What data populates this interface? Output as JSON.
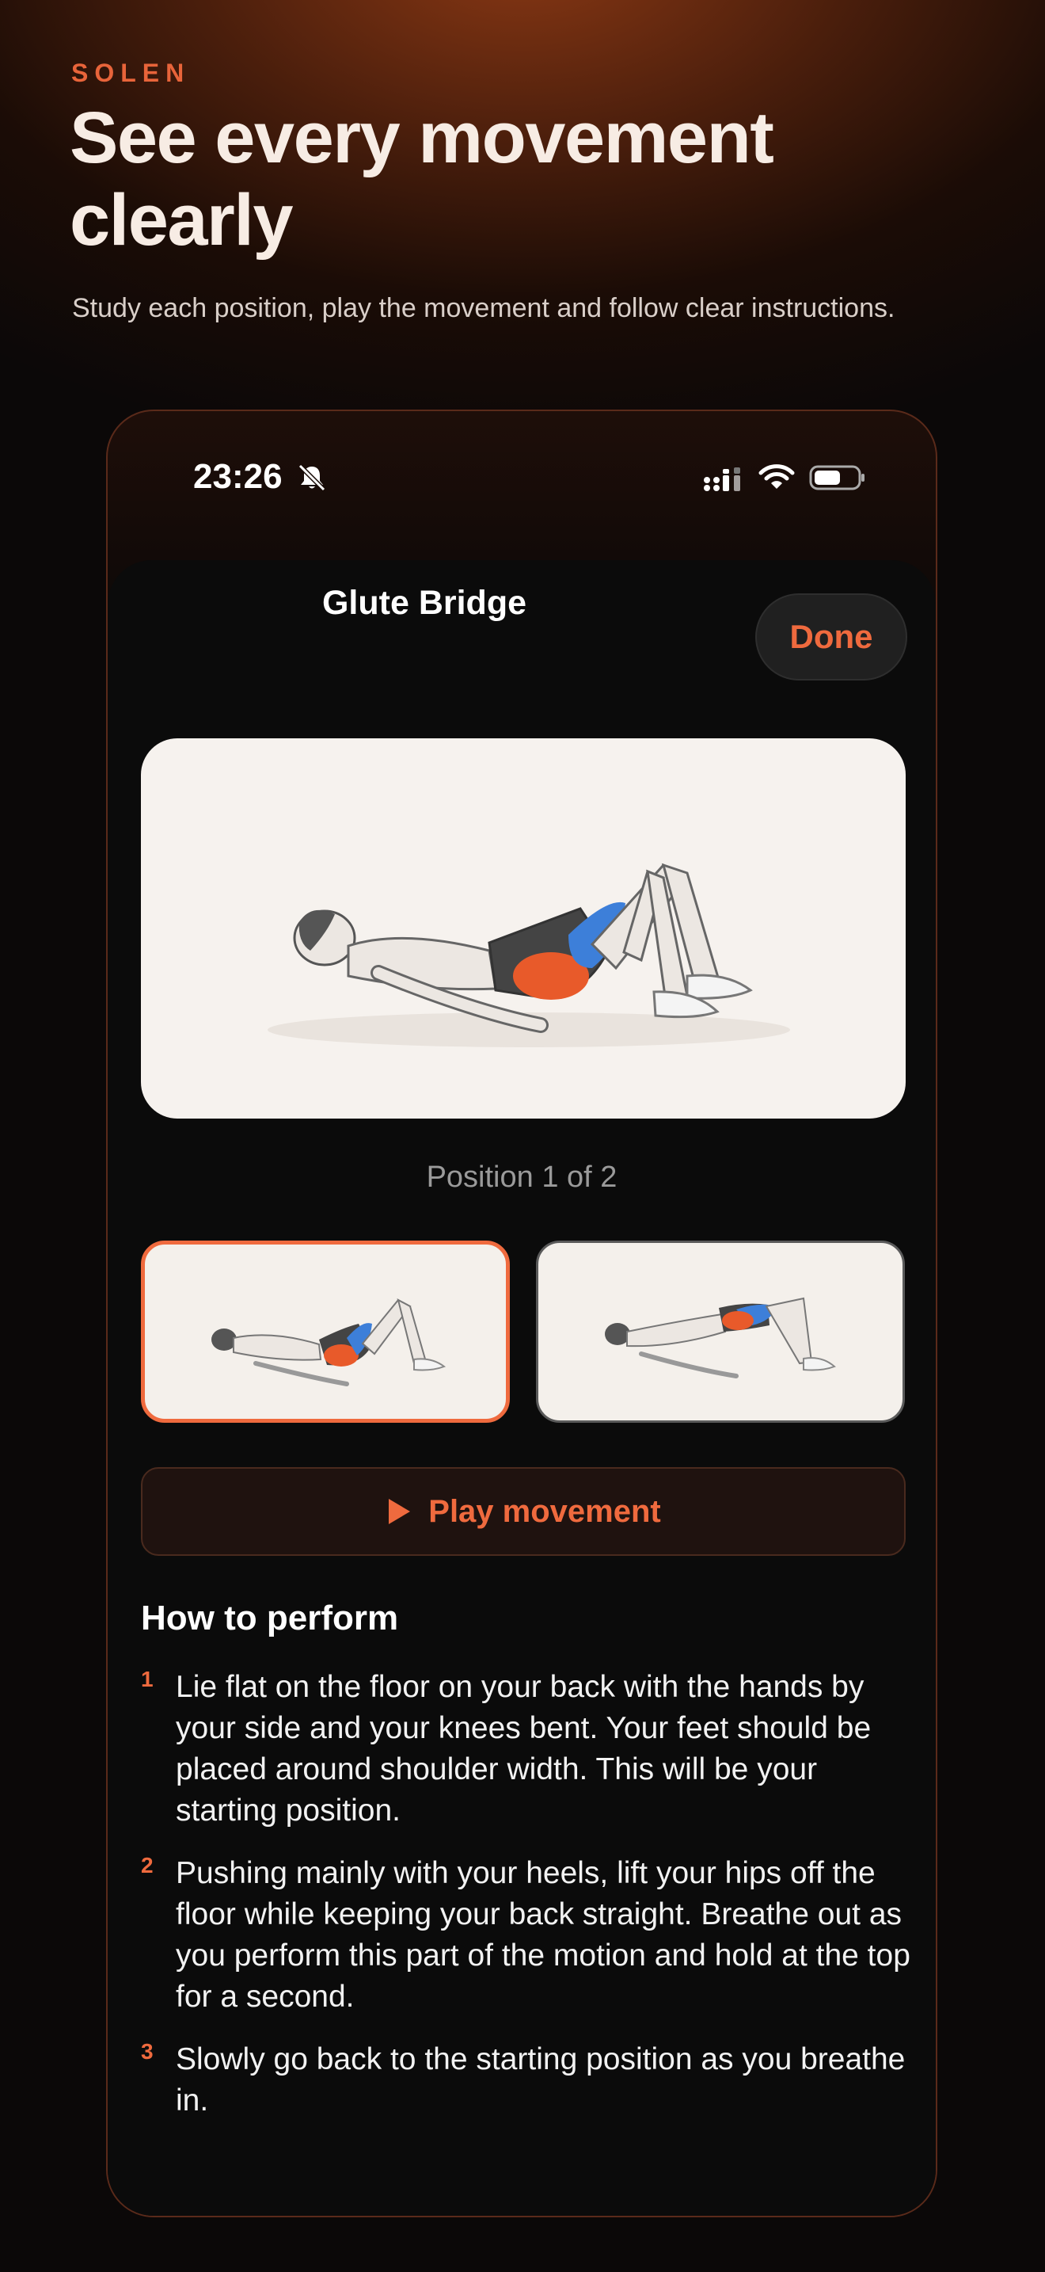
{
  "marketing": {
    "brand": "SOLEN",
    "headline": "See every movement clearly",
    "subtitle": "Study each position, play the movement and follow clear instructions."
  },
  "status_bar": {
    "time": "23:26",
    "icons": [
      "bell-slash-icon",
      "cellular-signal-icon",
      "wifi-icon",
      "battery-icon"
    ]
  },
  "exercise": {
    "title": "Glute Bridge",
    "done_label": "Done",
    "position_label": "Position 1 of 2",
    "selected_position": 1,
    "play_label": "Play movement",
    "howto_title": "How to perform",
    "steps": [
      {
        "num": "1",
        "text": "Lie flat on the floor on your back with the hands by your side and your knees bent. Your feet should be placed around shoulder width. This will be your starting position."
      },
      {
        "num": "2",
        "text": "Pushing mainly with your heels, lift your hips off the floor while keeping your back straight. Breathe out as you perform this part of the motion and hold at the top for a second."
      },
      {
        "num": "3",
        "text": "Slowly go back to the starting position as you breathe in."
      }
    ]
  },
  "colors": {
    "accent": "#ef6a3e",
    "muscle_primary": "#e85a2a",
    "muscle_secondary": "#3d7fd9",
    "card_bg": "#f6f2ee"
  }
}
